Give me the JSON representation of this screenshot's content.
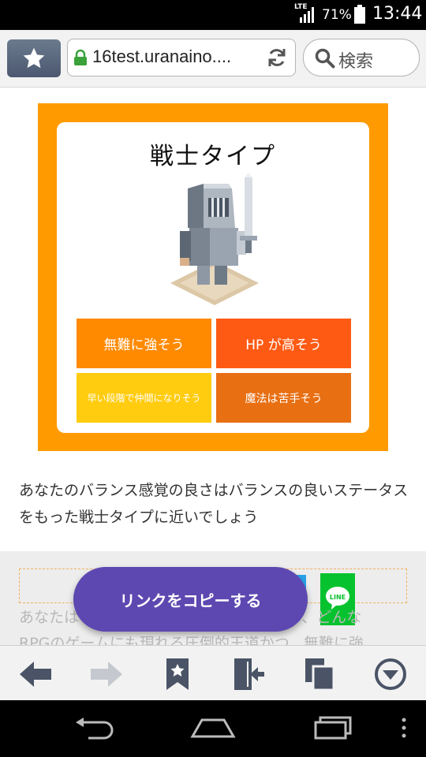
{
  "status_bar": {
    "network": "LTE",
    "battery_percent": "71%",
    "time": "13:44"
  },
  "browser": {
    "url": "16test.uranaino....",
    "search_placeholder": "検索"
  },
  "result": {
    "type_title": "戦士タイプ",
    "traits": [
      "無難に強そう",
      "HP が高そう",
      "早い段階で仲間になりそう",
      "魔法は苦手そう"
    ],
    "description": "あなたのバランス感覚の良さはバランスの良いステータスをもった戦士タイプに近いでしょう",
    "card_color": "#ff9b00",
    "trait_colors": [
      "#ff8a00",
      "#ff5a14",
      "#ffcc10",
      "#e86f12"
    ]
  },
  "share": {
    "copy_link_label": "リンクをコピーする",
    "line_label": "LINE",
    "button_color": "#5d48b1"
  },
  "faded_text": {
    "line1": "あなたは",
    "line1_right": "り、どんな",
    "line2": "RPGのゲームにも現れる圧倒的王道かつ、無難に強"
  },
  "toolbar": {
    "icons": [
      "back-arrow-icon",
      "forward-arrow-icon",
      "bookmark-icon",
      "exit-door-icon",
      "tabs-icon",
      "menu-down-icon"
    ]
  },
  "nav_bar": {
    "icons": [
      "back-icon",
      "home-icon",
      "recents-icon",
      "more-icon"
    ]
  }
}
